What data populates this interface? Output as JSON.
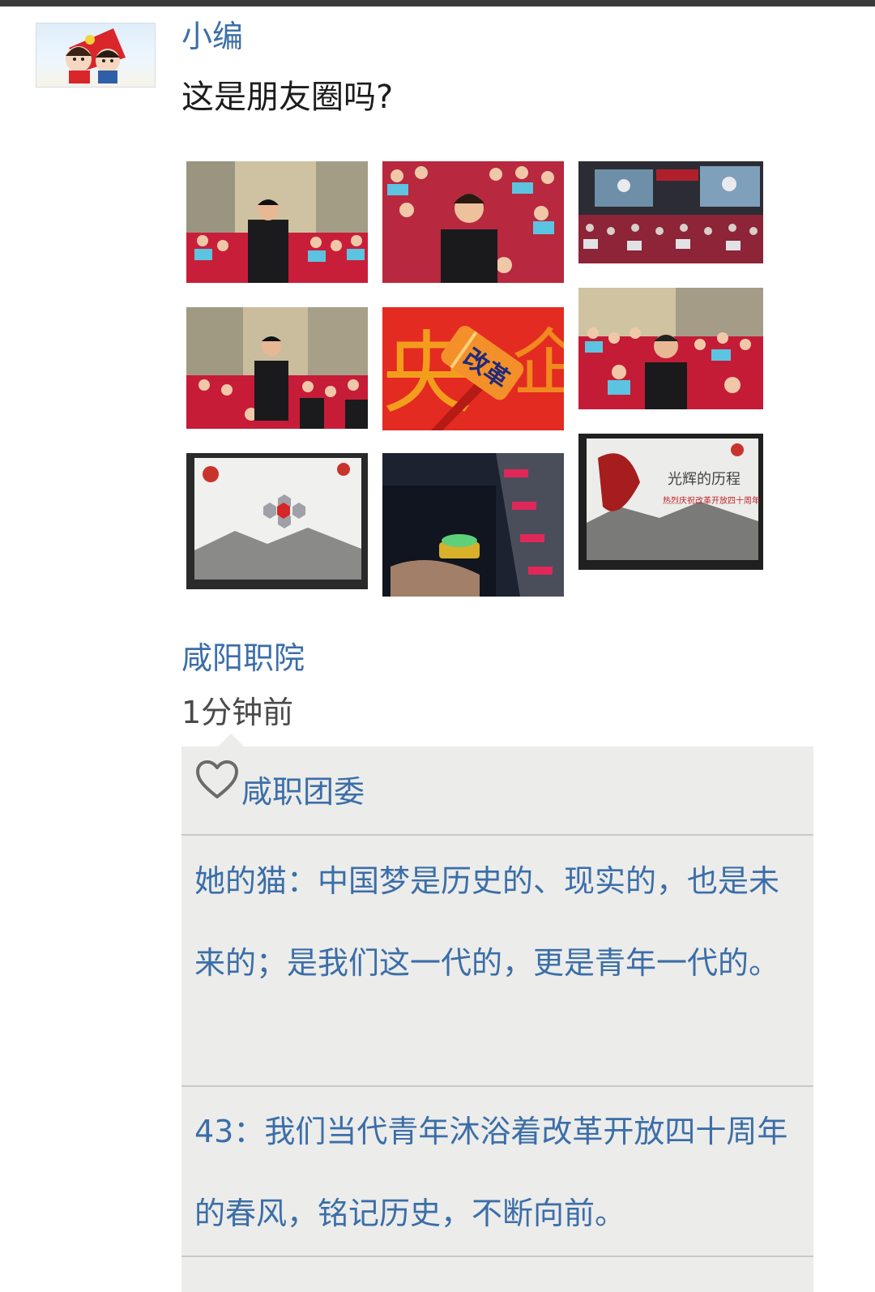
{
  "post": {
    "author": "小编",
    "text": "这是朋友圈吗?",
    "location": "咸阳职院",
    "time": "1分钟前"
  },
  "photos": [
    {
      "label": "student-asking-question-1"
    },
    {
      "label": "student-asking-question-2"
    },
    {
      "label": "auditorium-screens"
    },
    {
      "label": "student-asking-question-3"
    },
    {
      "label": "reform-hammer",
      "caption": "改革"
    },
    {
      "label": "student-asking-question-4"
    },
    {
      "label": "presentation-slide"
    },
    {
      "label": "buzzer-desk"
    },
    {
      "label": "glorious-journey-slide",
      "caption": "光辉的历程"
    }
  ],
  "interactions": {
    "likes": [
      "咸职团委"
    ],
    "comments": [
      {
        "author": "她的猫",
        "text": "她的猫：中国梦是历史的、现实的，也是未来的；是我们这一代的，更是青年一代的。"
      },
      {
        "author": "43",
        "text": "43：我们当代青年沐浴着改革开放四十周年的春风，铭记历史，不断向前。"
      }
    ]
  },
  "colors": {
    "link": "#3b6ea8",
    "comment_bg": "#ececea",
    "divider": "#c9c9c7"
  }
}
